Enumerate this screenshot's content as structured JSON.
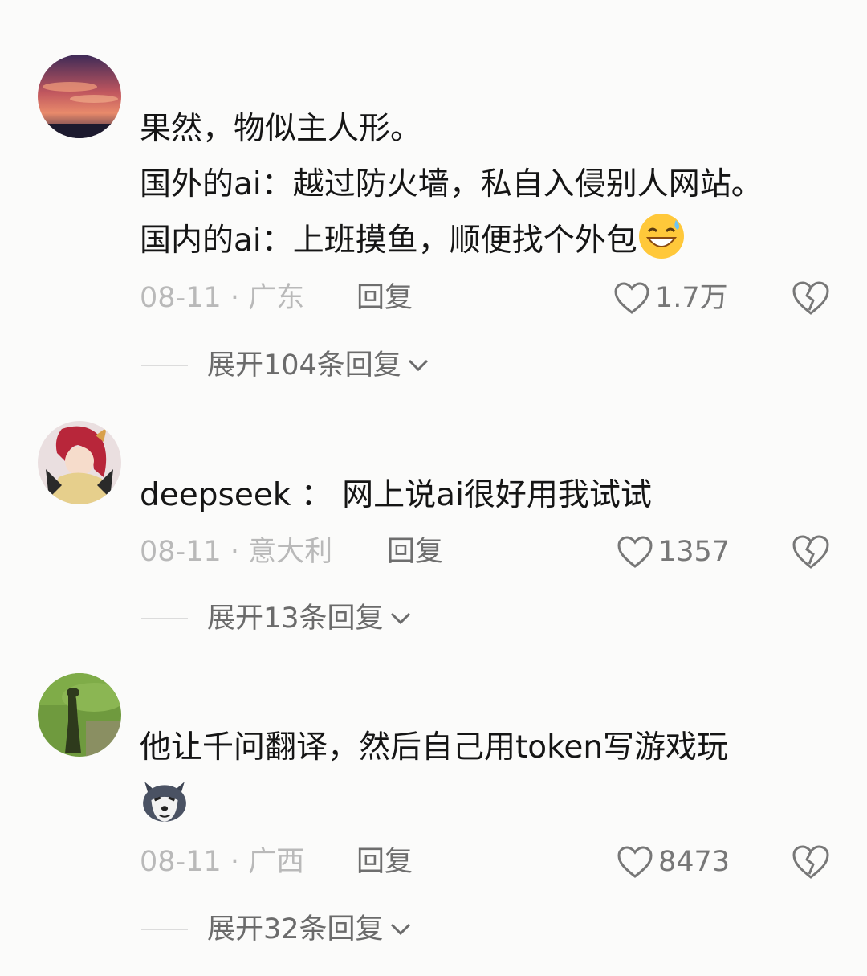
{
  "comments": [
    {
      "lines": [
        "果然，物似主人形。",
        "国外的ai：越过防火墙，私自入侵别人网站。",
        "国内的ai：上班摸鱼，顺便找个外包"
      ],
      "trailing_emoji": "grinning-sweat-emoji",
      "date": "08-11",
      "location": "· 广东",
      "reply_label": "回复",
      "likes": "1.7万",
      "expand_label": "展开104条回复"
    },
    {
      "lines": [
        "deepseek ： 网上说ai很好用我试试"
      ],
      "date": "08-11",
      "location": "· 意大利",
      "reply_label": "回复",
      "likes": "1357",
      "expand_label": "展开13条回复"
    },
    {
      "lines": [
        "他让千问翻译，然后自己用token写游戏玩"
      ],
      "trailing_emoji": "husky-dog-emoji",
      "date": "08-11",
      "location": "· 广西",
      "reply_label": "回复",
      "likes": "8473",
      "expand_label": "展开32条回复"
    }
  ],
  "icons": {
    "like": "heart-outline-icon",
    "dislike": "broken-heart-icon",
    "expand": "chevron-down-icon"
  },
  "colors": {
    "background": "#fbfbfa",
    "text": "#151515",
    "meta": "#b9b9b9",
    "reply": "#6e6e6e"
  }
}
